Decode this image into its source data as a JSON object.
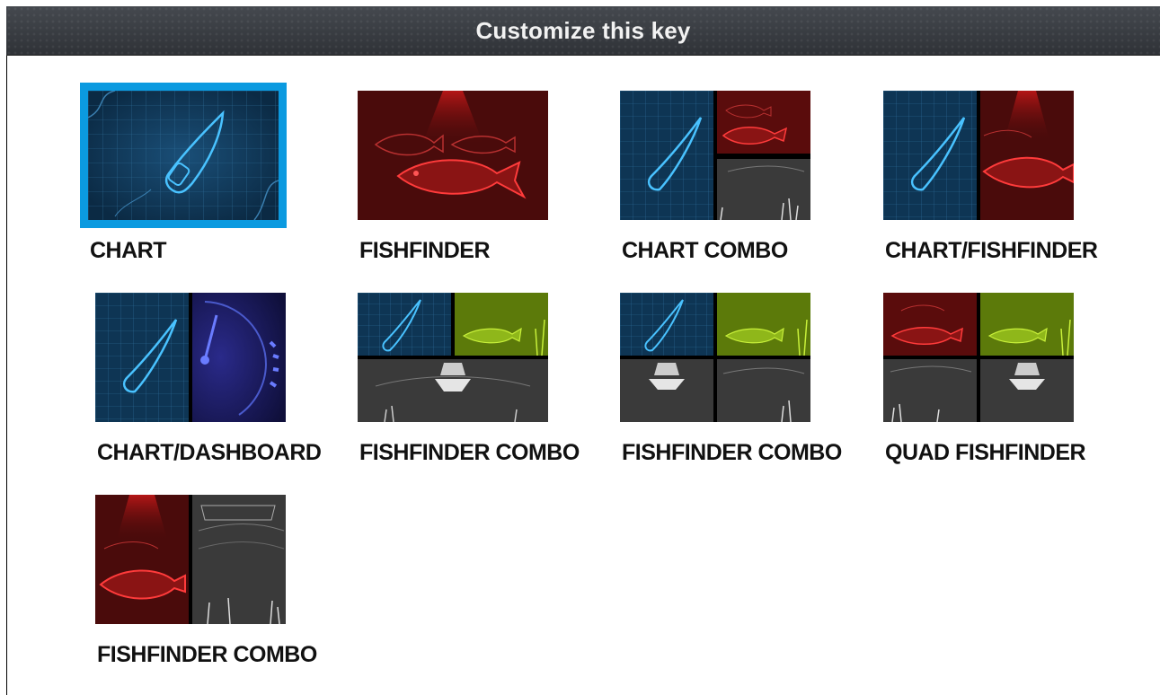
{
  "header": {
    "title": "Customize this key"
  },
  "colors": {
    "selection": "#0b9ae0",
    "chart": "#0e3554",
    "fishfinder": "#5a0c0c",
    "sonar_green": "#8fb71a",
    "sonar_gray": "#3a3a3a"
  },
  "tiles": [
    {
      "label": "CHART",
      "icon": "chart-icon",
      "selected": true
    },
    {
      "label": "FISHFINDER",
      "icon": "fishfinder-icon",
      "selected": false
    },
    {
      "label": "CHART COMBO",
      "icon": "chart-combo-icon",
      "selected": false
    },
    {
      "label": "CHART/FISHFINDER",
      "icon": "chart-fishfinder-icon",
      "selected": false
    },
    {
      "label": "CHART/DASHBOARD",
      "icon": "chart-dashboard-icon",
      "selected": false
    },
    {
      "label": "FISHFINDER COMBO",
      "icon": "fishfinder-combo-icon",
      "selected": false
    },
    {
      "label": "FISHFINDER COMBO",
      "icon": "fishfinder-combo-icon",
      "selected": false
    },
    {
      "label": "QUAD FISHFINDER",
      "icon": "quad-fishfinder-icon",
      "selected": false
    },
    {
      "label": "FISHFINDER COMBO",
      "icon": "fishfinder-combo-icon",
      "selected": false
    }
  ]
}
